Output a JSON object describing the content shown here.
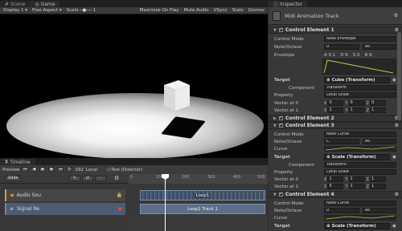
{
  "game": {
    "tabs": [
      "Scene",
      "Game"
    ],
    "toolbar": {
      "display": "Display 1",
      "aspect": "Free Aspect",
      "scale_label": "Scale",
      "scale_value": "1",
      "maximize": "Maximize On Play",
      "mute": "Mute Audio",
      "vsync": "VSync",
      "stats": "Stats",
      "gizmos": "Gizmos"
    }
  },
  "timeline": {
    "tab": "Timeline",
    "preview": "Preview",
    "frame": "292",
    "local": "Local",
    "asset": "Test (Director)",
    "add_label": "Add",
    "ruler_marks": [
      "0",
      "100",
      "200",
      "300",
      "400",
      "500"
    ],
    "tracks": [
      {
        "name": "Audio Sou",
        "clip": "Loop1"
      },
      {
        "name": "Signal Re",
        "clip": "Loop1 Track 1"
      }
    ]
  },
  "inspector": {
    "tab": "Inspector",
    "title": "Midi Animation Track",
    "control_mode_label": "Control Mode",
    "note_octave_label": "Note/Octave",
    "envelope_label": "Envelope",
    "curve_label": "Curve",
    "target_label": "Target",
    "component_label": "Component",
    "property_label": "Property",
    "vec0_label": "Vector at 0",
    "vec1_label": "Vector at 1",
    "element1": {
      "title": "Control Element 1",
      "control_mode": "Note Envelope",
      "note": "0",
      "octave": "All",
      "envelope": [
        "A 0.1",
        "D 6",
        "S 0",
        "R 6"
      ],
      "target": "Cube (Transform)",
      "component": "Transform",
      "property": "Local Scale",
      "vec0": [
        "0",
        "0",
        "0"
      ],
      "vec1": [
        "1",
        "1",
        "1"
      ]
    },
    "element2": {
      "title": "Control Element 2"
    },
    "element3": {
      "title": "Control Element 3",
      "control_mode": "Note Curve",
      "note": "C",
      "octave": "All",
      "target": "Scale (Transform)",
      "component": "Transform",
      "property": "Local Scale",
      "vec0": [
        "1",
        "1",
        "1"
      ],
      "vec1": [
        "5",
        "1",
        "1"
      ]
    },
    "element4": {
      "title": "Control Element 4",
      "control_mode": "Note Curve",
      "note": "0",
      "octave": "All",
      "target": "Scale (Transform)"
    }
  }
}
